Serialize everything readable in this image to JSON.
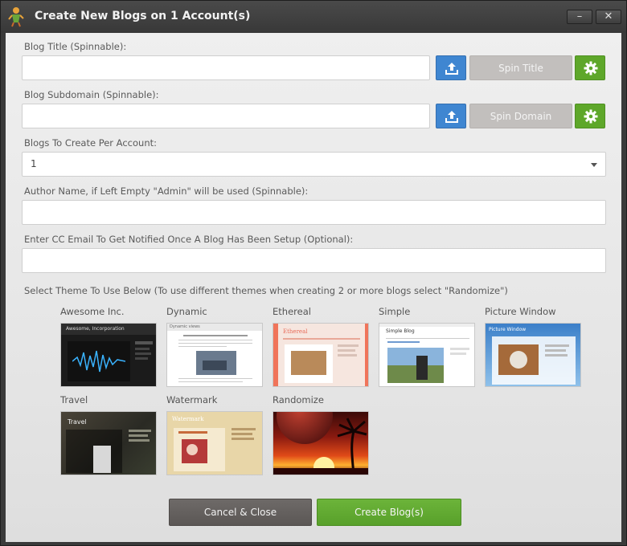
{
  "window": {
    "title": "Create New Blogs on 1 Account(s)",
    "minimize_label": "–",
    "close_label": "✕"
  },
  "form": {
    "blog_title": {
      "label": "Blog Title (Spinnable):",
      "value": "",
      "spin_label": "Spin Title"
    },
    "blog_subdomain": {
      "label": "Blog Subdomain (Spinnable):",
      "value": "",
      "spin_label": "Spin Domain"
    },
    "blogs_per_account": {
      "label": "Blogs To Create Per Account:",
      "selected": "1"
    },
    "author_name": {
      "label": "Author Name, if Left Empty \"Admin\" will be used (Spinnable):",
      "value": ""
    },
    "cc_email": {
      "label": "Enter CC Email To Get Notified Once A Blog Has Been Setup (Optional):",
      "value": ""
    }
  },
  "themes": {
    "label": "Select Theme To Use Below (To use different themes when creating 2 or more blogs select \"Randomize\")",
    "items": [
      {
        "name": "Awesome Inc.",
        "thumb_text": "Awesome, Incorporation"
      },
      {
        "name": "Dynamic",
        "thumb_text": "Dynamic views"
      },
      {
        "name": "Ethereal",
        "thumb_text": "Ethereal"
      },
      {
        "name": "Simple",
        "thumb_text": "Simple Blog"
      },
      {
        "name": "Picture Window",
        "thumb_text": "Picture Window"
      },
      {
        "name": "Travel",
        "thumb_text": "Travel"
      },
      {
        "name": "Watermark",
        "thumb_text": "Watermark"
      },
      {
        "name": "Randomize",
        "thumb_text": ""
      }
    ]
  },
  "actions": {
    "cancel_label": "Cancel & Close",
    "create_label": "Create Blog(s)"
  },
  "colors": {
    "upload_blue": "#3f86d1",
    "gear_green": "#5ea72a",
    "create_green": "#5ea72a",
    "spin_gray": "#c2bfbd"
  }
}
